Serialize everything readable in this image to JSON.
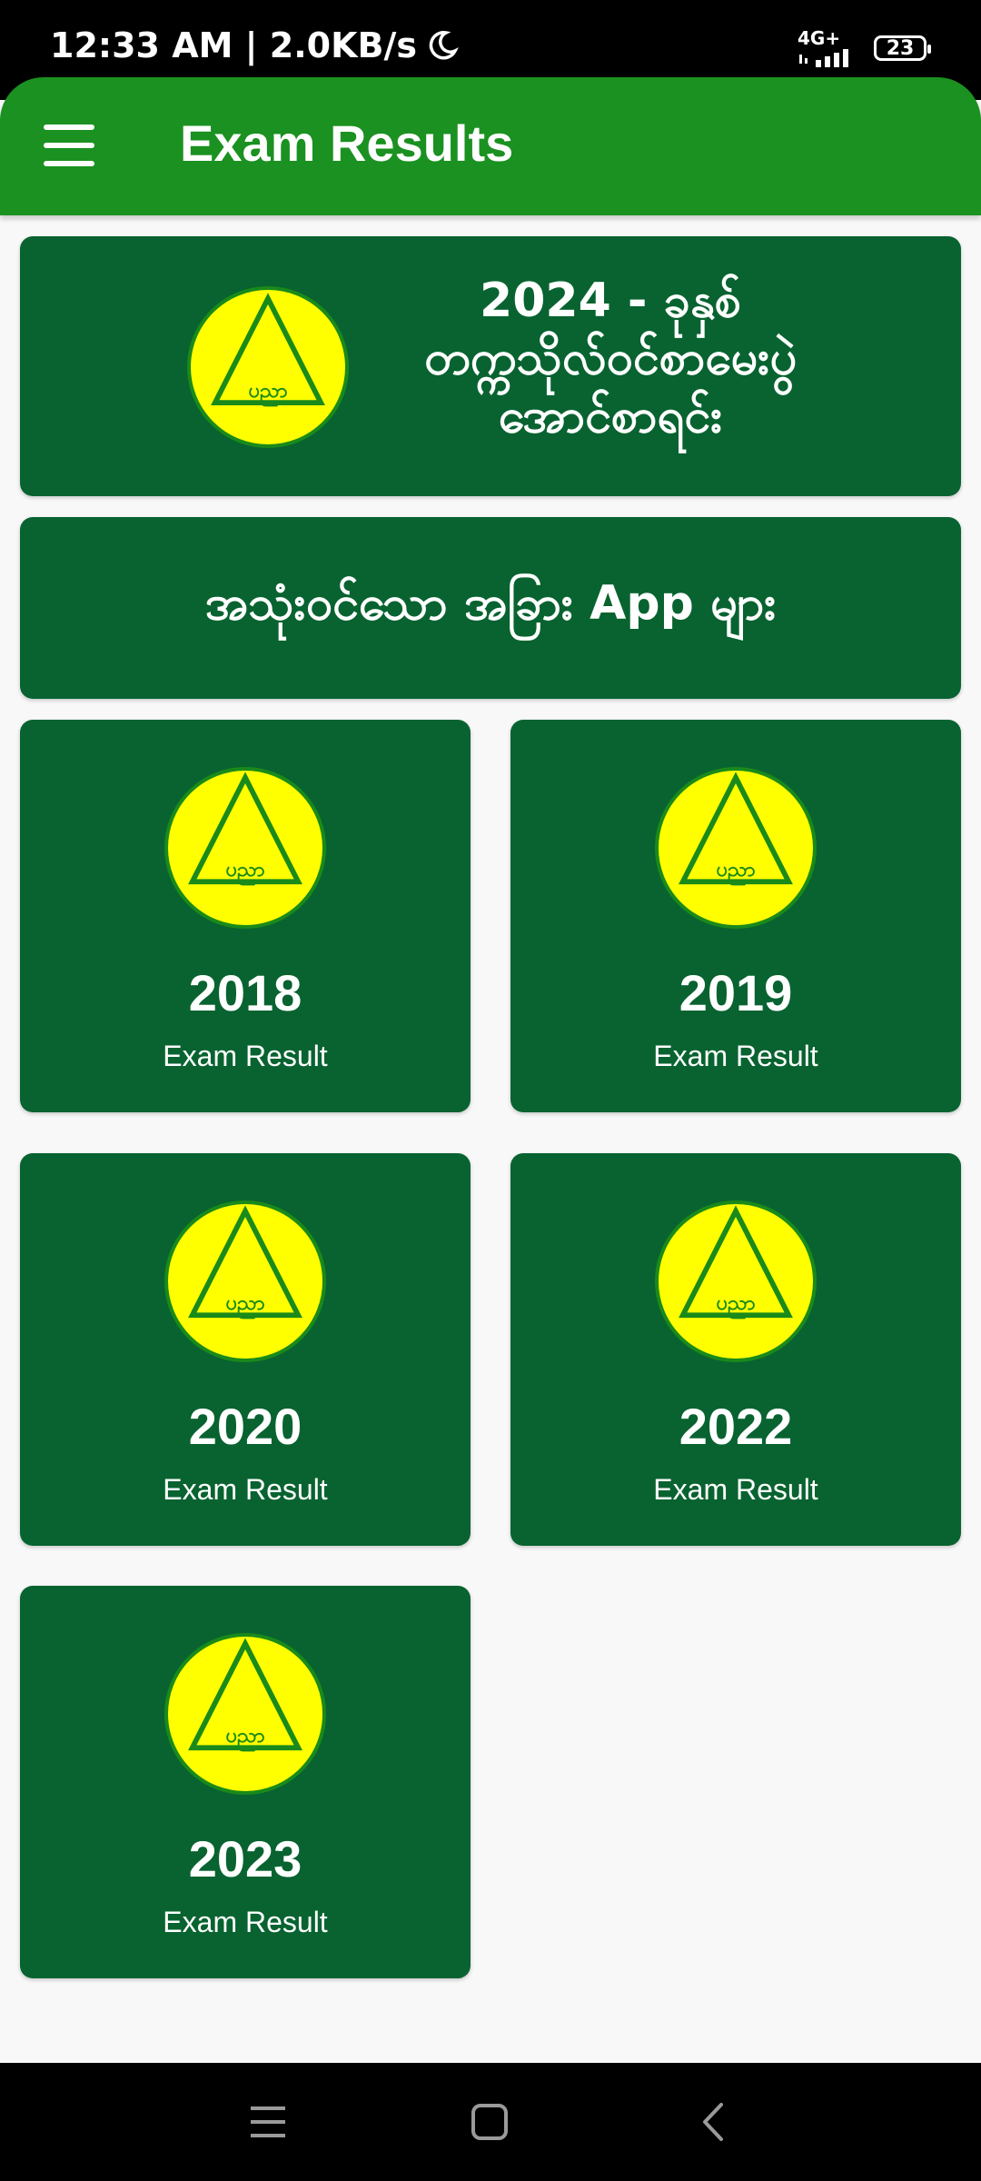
{
  "status_bar": {
    "time_speed": "12:33 AM | 2.0KB/s",
    "network": "4G+",
    "battery": "23"
  },
  "app_bar": {
    "title": "Exam Results"
  },
  "banner": {
    "lines": [
      "2024 - ခုနှစ်",
      "တက္ကသိုလ်ဝင်စာမေးပွဲ",
      "အောင်စာရင်း"
    ],
    "logo_text": "ပညာ"
  },
  "other_apps": {
    "label": "အသုံးဝင်သော အခြား App များ"
  },
  "results": [
    {
      "year": "2018",
      "label": "Exam Result"
    },
    {
      "year": "2019",
      "label": "Exam Result"
    },
    {
      "year": "2020",
      "label": "Exam Result"
    },
    {
      "year": "2022",
      "label": "Exam Result"
    },
    {
      "year": "2023",
      "label": "Exam Result"
    }
  ],
  "colors": {
    "app_bar": "#1a9120",
    "card": "#086330",
    "logo_fill": "#ffff00",
    "logo_stroke": "#1a8a1a",
    "background": "#f8f8f8"
  },
  "icons": {
    "menu": "hamburger-menu-icon",
    "moon": "moon-icon",
    "signal": "signal-icon",
    "battery": "battery-icon",
    "nav_recents": "recents-icon",
    "nav_home": "home-icon",
    "nav_back": "back-icon"
  }
}
